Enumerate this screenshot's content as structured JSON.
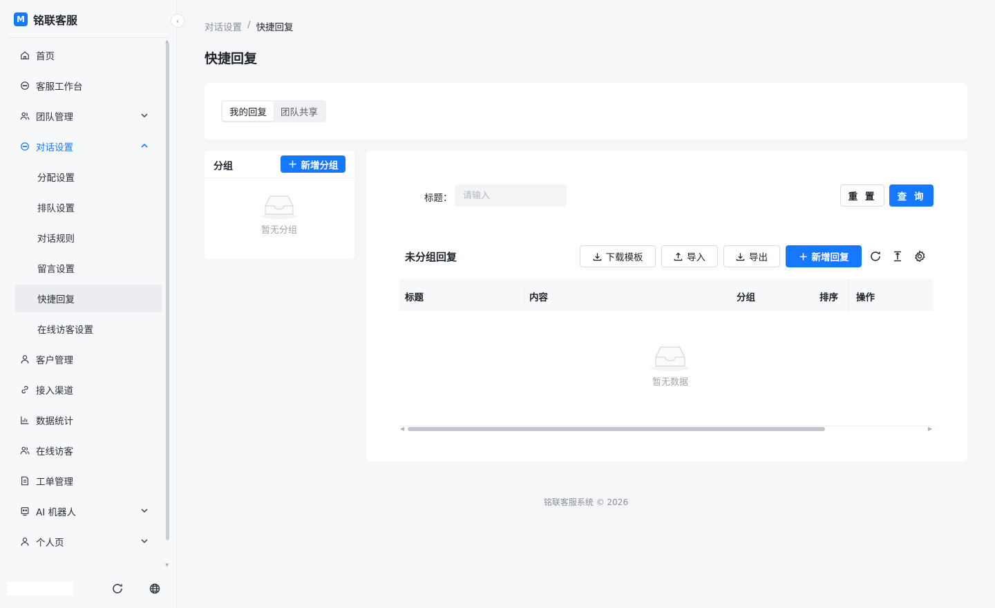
{
  "brand": {
    "logo_text": "M",
    "name": "铭联客服"
  },
  "sidebar": {
    "items": [
      {
        "label": "首页",
        "icon": "home-icon"
      },
      {
        "label": "客服工作台",
        "icon": "chat-icon"
      },
      {
        "label": "团队管理",
        "icon": "team-icon",
        "expandable": true
      },
      {
        "label": "对话设置",
        "icon": "chat-icon",
        "expanded": true,
        "children": [
          "分配设置",
          "排队设置",
          "对话规则",
          "留言设置",
          "快捷回复",
          "在线访客设置"
        ],
        "selected_child": "快捷回复"
      },
      {
        "label": "客户管理",
        "icon": "user-icon"
      },
      {
        "label": "接入渠道",
        "icon": "link-icon"
      },
      {
        "label": "数据统计",
        "icon": "bar-chart-icon"
      },
      {
        "label": "在线访客",
        "icon": "visitor-icon"
      },
      {
        "label": "工单管理",
        "icon": "document-icon"
      },
      {
        "label": "AI 机器人",
        "icon": "robot-icon",
        "expandable": true
      },
      {
        "label": "个人页",
        "icon": "user-icon",
        "expandable": true
      }
    ]
  },
  "breadcrumb": {
    "parent": "对话设置",
    "separator": "/",
    "current": "快捷回复"
  },
  "page": {
    "title": "快捷回复"
  },
  "tabs": {
    "items": [
      "我的回复",
      "团队共享"
    ],
    "active": "我的回复"
  },
  "groups": {
    "title": "分组",
    "add_label": "新增分组",
    "empty_text": "暂无分组"
  },
  "filter": {
    "title_label": "标题：",
    "title_placeholder": "请输入",
    "title_value": "",
    "reset_label": "重 置",
    "query_label": "查 询"
  },
  "list": {
    "title": "未分组回复",
    "download_template_label": "下载模板",
    "import_label": "导入",
    "export_label": "导出",
    "add_label": "新增回复",
    "columns": [
      "标题",
      "内容",
      "分组",
      "排序",
      "操作"
    ],
    "rows": [],
    "empty_text": "暂无数据"
  },
  "footer": {
    "text": "铭联客服系统 © 2026"
  },
  "colors": {
    "primary": "#1677ff",
    "sidebar_bg": "#f7f8fa",
    "page_bg": "#f5f6f8"
  }
}
